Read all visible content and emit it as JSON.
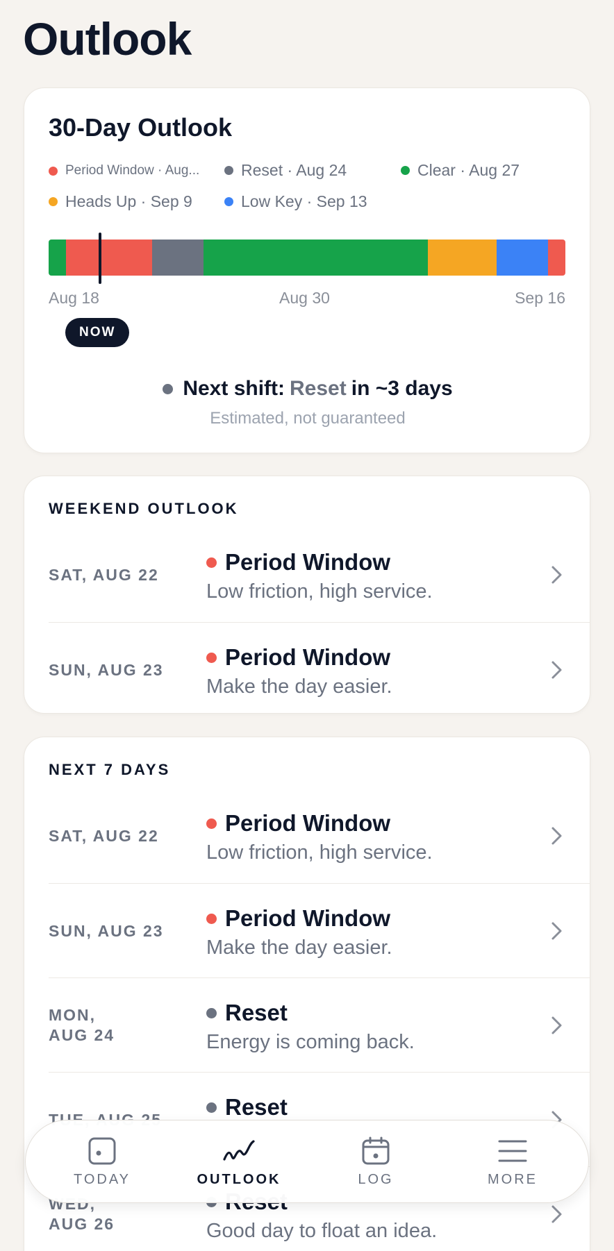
{
  "page": {
    "title": "Outlook"
  },
  "colors": {
    "period_window": "#ef5a4f",
    "reset": "#6b7280",
    "clear": "#16a34a",
    "heads_up": "#f5a623",
    "low_key": "#3b82f6",
    "ink": "#0f172a"
  },
  "outlook": {
    "title": "30-Day Outlook",
    "legend": [
      {
        "label": "Period Window · Aug...",
        "color": "#ef5a4f"
      },
      {
        "label": "Reset · Aug 24",
        "color": "#6b7280"
      },
      {
        "label": "Clear · Aug 27",
        "color": "#16a34a"
      },
      {
        "label": "Heads Up · Sep 9",
        "color": "#f5a623"
      },
      {
        "label": "Low Key · Sep 13",
        "color": "#3b82f6"
      }
    ],
    "segments": [
      {
        "phase": "Clear",
        "days": 1,
        "color": "#16a34a"
      },
      {
        "phase": "Period Window",
        "days": 5,
        "color": "#ef5a4f"
      },
      {
        "phase": "Reset",
        "days": 3,
        "color": "#6b7280"
      },
      {
        "phase": "Clear",
        "days": 13,
        "color": "#16a34a"
      },
      {
        "phase": "Heads Up",
        "days": 4,
        "color": "#f5a623"
      },
      {
        "phase": "Low Key",
        "days": 3,
        "color": "#3b82f6"
      },
      {
        "phase": "Period Window",
        "days": 1,
        "color": "#ef5a4f"
      }
    ],
    "now_day_index": 3,
    "axis": {
      "start": "Aug 18",
      "mid": "Aug 30",
      "end": "Sep 16"
    },
    "now_label": "NOW",
    "next_shift": {
      "prefix": "Next shift:",
      "phase": "Reset",
      "suffix": "in ~3 days",
      "note": "Estimated, not guaranteed"
    }
  },
  "weekend": {
    "title": "WEEKEND OUTLOOK",
    "rows": [
      {
        "date": "SAT, AUG 22",
        "phase": "Period Window",
        "color": "#ef5a4f",
        "desc": "Low friction, high service."
      },
      {
        "date": "SUN, AUG 23",
        "phase": "Period Window",
        "color": "#ef5a4f",
        "desc": "Make the day easier."
      }
    ]
  },
  "next7": {
    "title": "NEXT 7 DAYS",
    "rows": [
      {
        "date": "SAT, AUG 22",
        "phase": "Period Window",
        "color": "#ef5a4f",
        "desc": "Low friction, high service."
      },
      {
        "date": "SUN, AUG 23",
        "phase": "Period Window",
        "color": "#ef5a4f",
        "desc": "Make the day easier."
      },
      {
        "date_line1": "MON,",
        "date_line2": "AUG 24",
        "phase": "Reset",
        "color": "#6b7280",
        "desc": "Energy is coming back."
      },
      {
        "date": "TUE, AUG 25",
        "phase": "Reset",
        "color": "#6b7280",
        "desc": ""
      },
      {
        "date_line1": "WED,",
        "date_line2": "AUG 26",
        "phase": "Reset",
        "color": "#6b7280",
        "desc": "Good day to float an idea."
      }
    ]
  },
  "tabbar": {
    "tabs": [
      {
        "label": "TODAY",
        "icon": "today-icon"
      },
      {
        "label": "OUTLOOK",
        "icon": "trend-icon",
        "active": true
      },
      {
        "label": "LOG",
        "icon": "calendar-icon"
      },
      {
        "label": "MORE",
        "icon": "menu-icon"
      }
    ]
  }
}
